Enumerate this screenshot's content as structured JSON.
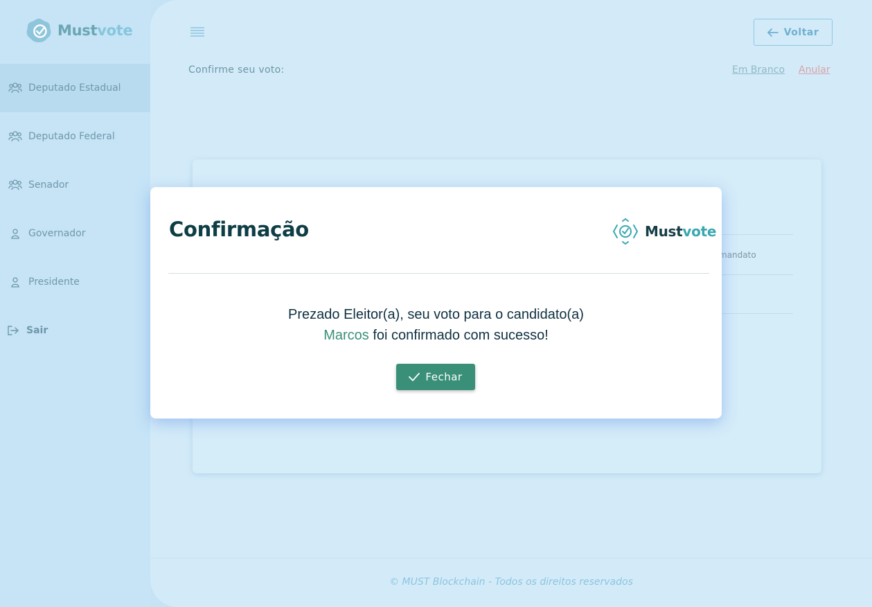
{
  "brand": {
    "name_part1": "Must",
    "name_part2": "vote"
  },
  "sidebar": {
    "items": [
      {
        "label": "Deputado Estadual",
        "icon": "group-icon"
      },
      {
        "label": "Deputado Federal",
        "icon": "group-icon"
      },
      {
        "label": "Senador",
        "icon": "group-icon"
      },
      {
        "label": "Governador",
        "icon": "user-icon"
      },
      {
        "label": "Presidente",
        "icon": "user-icon"
      }
    ],
    "logout_label": "Sair"
  },
  "header": {
    "back_label": "Voltar"
  },
  "vote": {
    "confirm_label": "Confirme seu voto:",
    "blank_label": "Em Branco",
    "null_label": "Anular",
    "card_fragment": "mandato"
  },
  "modal": {
    "title": "Confirmação",
    "message_line1": "Prezado Eleitor(a), seu voto para o candidato(a)",
    "candidate_name": "Marcos",
    "message_line2_rest": " foi confirmado com sucesso!",
    "close_label": "Fechar"
  },
  "footer": {
    "text": "© MUST Blockchain - Todos os direitos reservados"
  },
  "colors": {
    "accent_green": "#3a8f78",
    "title_dark": "#0e3d45",
    "danger_link": "#d8a2ab",
    "brand_teal": "#3aa8b0"
  }
}
